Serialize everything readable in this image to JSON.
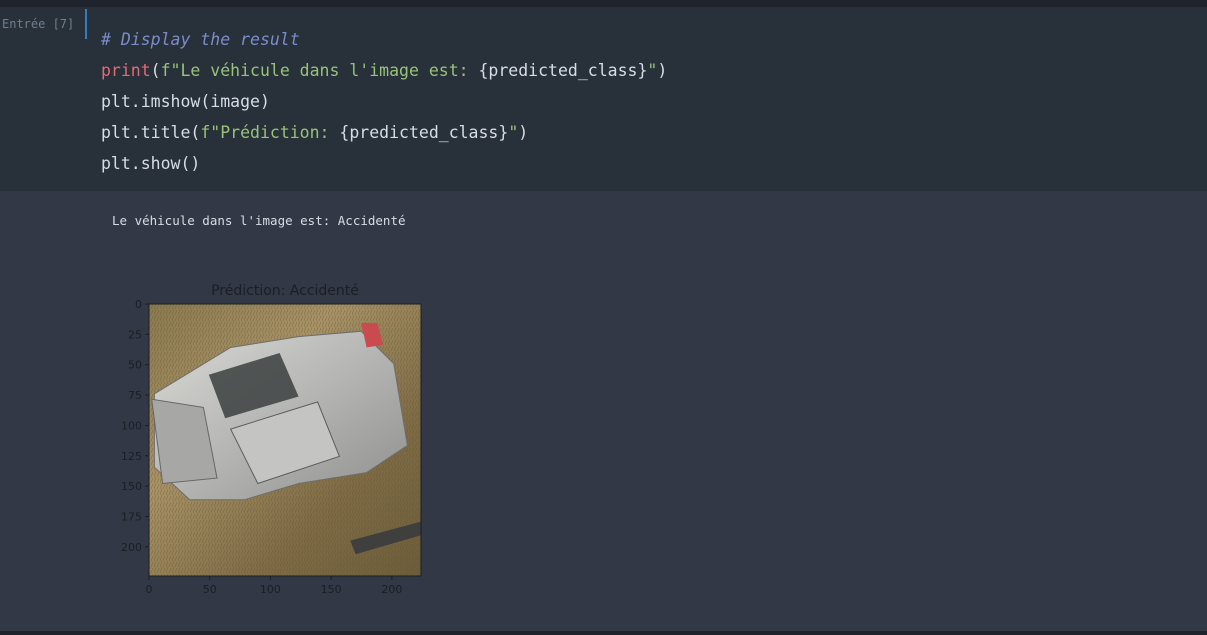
{
  "cell": {
    "prompt": "Entrée [7]",
    "code": {
      "line1": "# Display the result",
      "line2_fn": "print",
      "line2_open": "(",
      "line2_str": "f\"Le véhicule dans l'image est: ",
      "line2_var": "{predicted_class}",
      "line2_end_str": "\"",
      "line2_close": ")",
      "line3": "plt.imshow(image)",
      "line4_pre": "plt.title(",
      "line4_str": "f\"Prédiction: ",
      "line4_var": "{predicted_class}",
      "line4_end_str": "\"",
      "line4_close": ")",
      "line5": "plt.show()"
    }
  },
  "output": {
    "stdout": "Le véhicule dans l'image est: Accidenté",
    "figure": {
      "title": "Prédiction: Accidenté",
      "yticks": [
        "0",
        "25",
        "50",
        "75",
        "100",
        "125",
        "150",
        "175",
        "200"
      ],
      "xticks": [
        "0",
        "50",
        "100",
        "150",
        "200"
      ]
    }
  },
  "chart_data": {
    "type": "image",
    "title": "Prédiction: Accidenté",
    "x_ticks": [
      0,
      50,
      100,
      150,
      200
    ],
    "y_ticks": [
      0,
      25,
      50,
      75,
      100,
      125,
      150,
      175,
      200
    ],
    "xlim": [
      0,
      224
    ],
    "ylim": [
      224,
      0
    ],
    "grid": false
  }
}
